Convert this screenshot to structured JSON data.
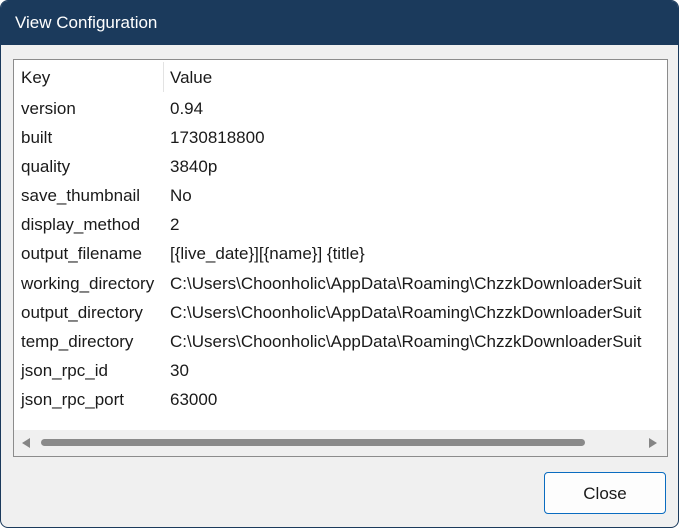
{
  "window": {
    "title": "View Configuration"
  },
  "table": {
    "columns": {
      "key": "Key",
      "value": "Value"
    },
    "rows": [
      {
        "key": "version",
        "value": "0.94"
      },
      {
        "key": "built",
        "value": "1730818800"
      },
      {
        "key": "quality",
        "value": "3840p"
      },
      {
        "key": "save_thumbnail",
        "value": "No"
      },
      {
        "key": "display_method",
        "value": "2"
      },
      {
        "key": "output_filename",
        "value": "[{live_date}][{name}] {title}"
      },
      {
        "key": "working_directory",
        "value": "C:\\Users\\Choonholic\\AppData\\Roaming\\ChzzkDownloaderSuit"
      },
      {
        "key": "output_directory",
        "value": "C:\\Users\\Choonholic\\AppData\\Roaming\\ChzzkDownloaderSuit"
      },
      {
        "key": "temp_directory",
        "value": "C:\\Users\\Choonholic\\AppData\\Roaming\\ChzzkDownloaderSuit"
      },
      {
        "key": "json_rpc_id",
        "value": "30"
      },
      {
        "key": "json_rpc_port",
        "value": "63000"
      }
    ]
  },
  "footer": {
    "close_label": "Close"
  },
  "colors": {
    "titlebar": "#1b3a5c",
    "button_border": "#0a6cc0"
  }
}
